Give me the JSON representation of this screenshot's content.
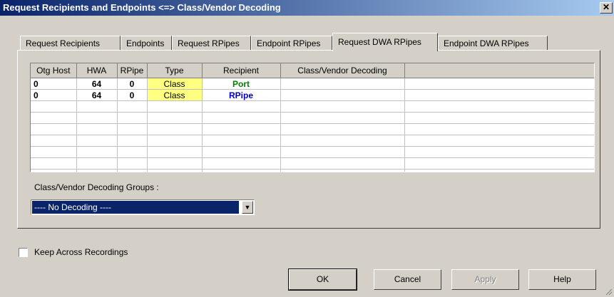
{
  "window": {
    "title": "Request Recipients and Endpoints <=> Class/Vendor Decoding",
    "close": "✕"
  },
  "tabs": [
    {
      "label": "Request Recipients"
    },
    {
      "label": "Endpoints"
    },
    {
      "label": "Request RPipes"
    },
    {
      "label": "Endpoint RPipes"
    },
    {
      "label": "Request DWA RPipes",
      "active": true
    },
    {
      "label": "Endpoint DWA RPipes"
    }
  ],
  "table": {
    "headers": [
      "Otg Host",
      "HWA",
      "RPipe",
      "Type",
      "Recipient",
      "Class/Vendor Decoding"
    ],
    "rows": [
      {
        "otg_host": "0",
        "hwa": "64",
        "rpipe": "0",
        "type": "Class",
        "recipient": "Port",
        "decoding": ""
      },
      {
        "otg_host": "0",
        "hwa": "64",
        "rpipe": "0",
        "type": "Class",
        "recipient": "RPipe",
        "decoding": ""
      }
    ]
  },
  "groups": {
    "label": "Class/Vendor Decoding Groups :",
    "selected": "---- No Decoding ----"
  },
  "keep_across": {
    "label": "Keep Across Recordings",
    "checked": false
  },
  "buttons": {
    "ok": "OK",
    "cancel": "Cancel",
    "apply": "Apply",
    "help": "Help"
  },
  "colors": {
    "titlebar_start": "#0a246a",
    "titlebar_end": "#a6caf0",
    "type_highlight": "#ffff80",
    "port_text": "#008000",
    "rpipe_text": "#0000c0"
  }
}
